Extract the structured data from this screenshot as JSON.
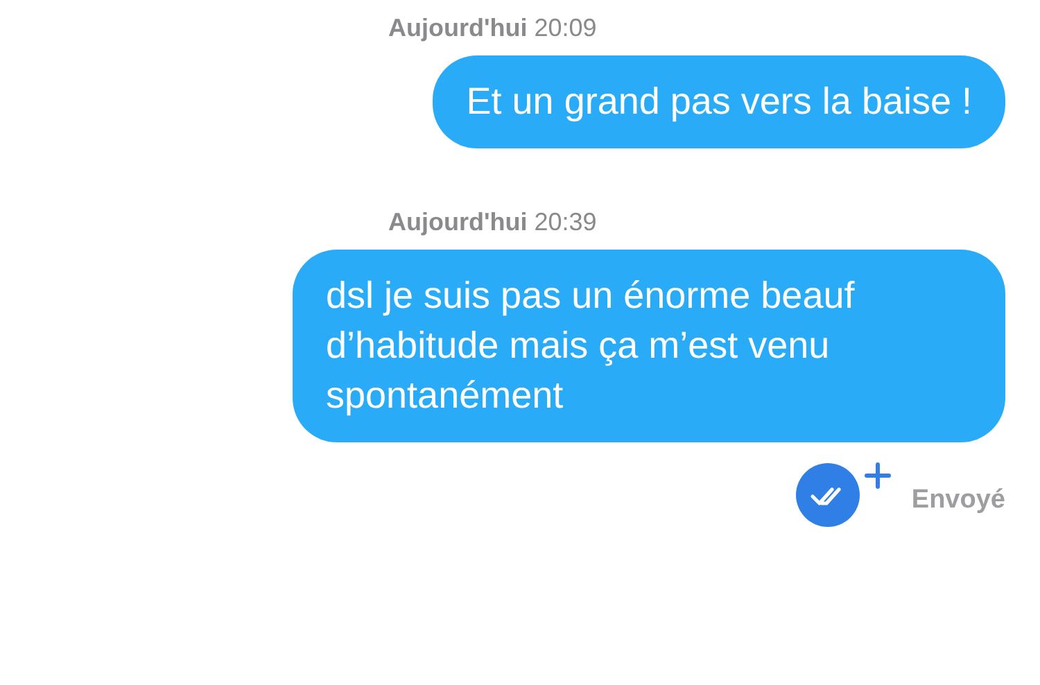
{
  "messages": [
    {
      "day": "Aujourd'hui",
      "time": "20:09",
      "text": "Et un grand pas vers la baise !"
    },
    {
      "day": "Aujourd'hui",
      "time": "20:39",
      "text": "dsl je suis pas un énorme beauf d’habitude mais ça m’est venu spontanément"
    }
  ],
  "status": {
    "label": "Envoyé",
    "read": true
  }
}
